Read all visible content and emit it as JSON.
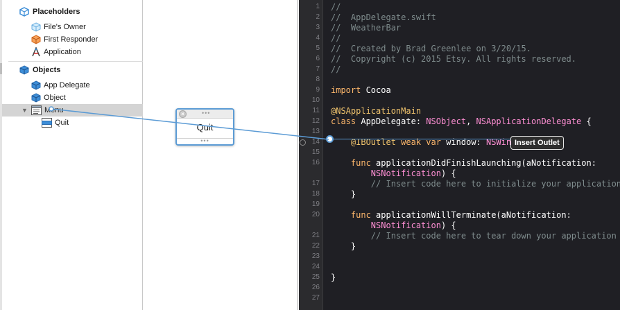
{
  "outline": {
    "placeholders": {
      "title": "Placeholders",
      "items": [
        "File's Owner",
        "First Responder",
        "Application"
      ]
    },
    "objects": {
      "title": "Objects",
      "items": [
        "App Delegate",
        "Object",
        "Menu",
        "Quit"
      ]
    }
  },
  "canvas": {
    "menu_item": "Quit"
  },
  "editor": {
    "tooltip": "Insert Outlet",
    "lines": [
      {
        "n": "1",
        "html": [
          {
            "c": "c-comment",
            "t": "//"
          }
        ]
      },
      {
        "n": "2",
        "html": [
          {
            "c": "c-comment",
            "t": "//  AppDelegate.swift"
          }
        ]
      },
      {
        "n": "3",
        "html": [
          {
            "c": "c-comment",
            "t": "//  WeatherBar"
          }
        ]
      },
      {
        "n": "4",
        "html": [
          {
            "c": "c-comment",
            "t": "//"
          }
        ]
      },
      {
        "n": "5",
        "html": [
          {
            "c": "c-comment",
            "t": "//  Created by Brad Greenlee on 3/20/15."
          }
        ]
      },
      {
        "n": "6",
        "html": [
          {
            "c": "c-comment",
            "t": "//  Copyright (c) 2015 Etsy. All rights reserved."
          }
        ]
      },
      {
        "n": "7",
        "html": [
          {
            "c": "c-comment",
            "t": "//"
          }
        ]
      },
      {
        "n": "8",
        "html": []
      },
      {
        "n": "9",
        "html": [
          {
            "c": "c-kw",
            "t": "import"
          },
          {
            "c": "c-plain",
            "t": " Cocoa"
          }
        ]
      },
      {
        "n": "10",
        "html": []
      },
      {
        "n": "11",
        "html": [
          {
            "c": "c-attr",
            "t": "@NSApplicationMain"
          }
        ]
      },
      {
        "n": "12",
        "html": [
          {
            "c": "c-kw",
            "t": "class"
          },
          {
            "c": "c-plain",
            "t": " AppDelegate: "
          },
          {
            "c": "c-type",
            "t": "NSObject"
          },
          {
            "c": "c-plain",
            "t": ", "
          },
          {
            "c": "c-type",
            "t": "NSApplicationDelegate"
          },
          {
            "c": "c-plain",
            "t": " {"
          }
        ]
      },
      {
        "n": "13",
        "html": []
      },
      {
        "n": "14",
        "html": [
          {
            "c": "c-plain",
            "t": "    "
          },
          {
            "c": "c-attr",
            "t": "@IBOutlet"
          },
          {
            "c": "c-kw",
            "t": " weak var"
          },
          {
            "c": "c-plain",
            "t": " window: "
          },
          {
            "c": "c-type",
            "t": "NSWind"
          }
        ]
      },
      {
        "n": "15",
        "html": []
      },
      {
        "n": "16",
        "html": [
          {
            "c": "c-plain",
            "t": "    "
          },
          {
            "c": "c-kw",
            "t": "func"
          },
          {
            "c": "c-plain",
            "t": " applicationDidFinishLaunching(aNotification:"
          }
        ]
      },
      {
        "n": "",
        "html": [
          {
            "c": "c-plain",
            "t": "        "
          },
          {
            "c": "c-type",
            "t": "NSNotification"
          },
          {
            "c": "c-plain",
            "t": ") {"
          }
        ]
      },
      {
        "n": "17",
        "html": [
          {
            "c": "c-plain",
            "t": "        "
          },
          {
            "c": "c-comment",
            "t": "// Insert code here to initialize your application"
          }
        ]
      },
      {
        "n": "18",
        "html": [
          {
            "c": "c-plain",
            "t": "    }"
          }
        ]
      },
      {
        "n": "19",
        "html": []
      },
      {
        "n": "20",
        "html": [
          {
            "c": "c-plain",
            "t": "    "
          },
          {
            "c": "c-kw",
            "t": "func"
          },
          {
            "c": "c-plain",
            "t": " applicationWillTerminate(aNotification:"
          }
        ]
      },
      {
        "n": "",
        "html": [
          {
            "c": "c-plain",
            "t": "        "
          },
          {
            "c": "c-type",
            "t": "NSNotification"
          },
          {
            "c": "c-plain",
            "t": ") {"
          }
        ]
      },
      {
        "n": "21",
        "html": [
          {
            "c": "c-plain",
            "t": "        "
          },
          {
            "c": "c-comment",
            "t": "// Insert code here to tear down your application"
          }
        ]
      },
      {
        "n": "22",
        "html": [
          {
            "c": "c-plain",
            "t": "    }"
          }
        ]
      },
      {
        "n": "23",
        "html": []
      },
      {
        "n": "24",
        "html": []
      },
      {
        "n": "25",
        "html": [
          {
            "c": "c-plain",
            "t": "}"
          }
        ]
      },
      {
        "n": "26",
        "html": []
      },
      {
        "n": "27",
        "html": []
      }
    ]
  }
}
